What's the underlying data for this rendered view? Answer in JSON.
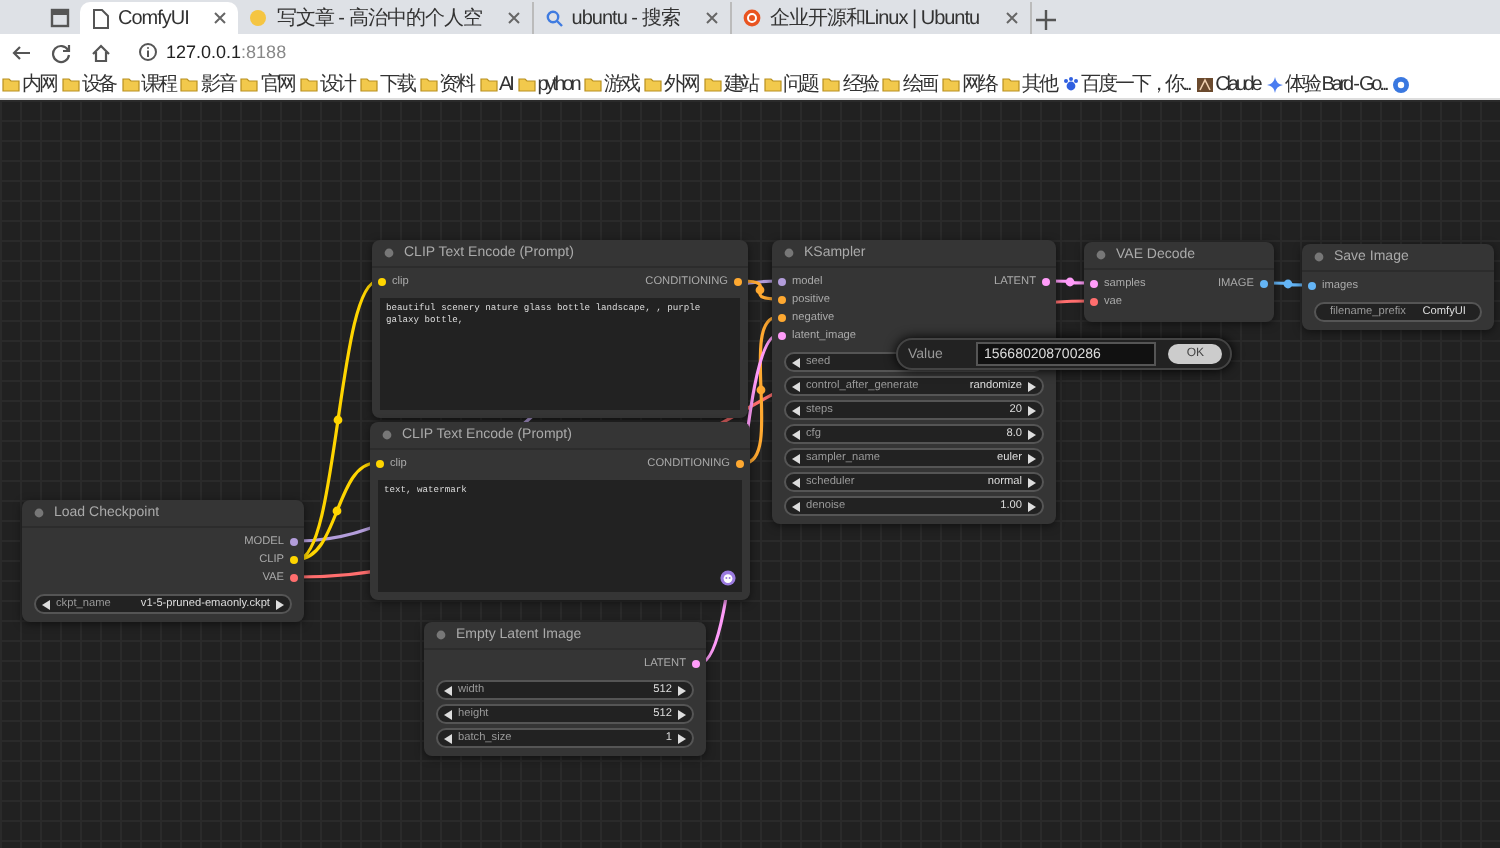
{
  "browser": {
    "tabs": [
      {
        "title": "ComfyUI",
        "selected": true
      },
      {
        "title": "写文章 - 高治中的个人空",
        "selected": false
      },
      {
        "title": "ubuntu - 搜索",
        "selected": false
      },
      {
        "title": "企业开源和Linux | Ubuntu",
        "selected": false
      }
    ],
    "url": {
      "host": "127.0.0.1",
      "port": ":8188"
    },
    "bookmarks": [
      {
        "label": "内网",
        "kind": "folder"
      },
      {
        "label": "设备",
        "kind": "folder"
      },
      {
        "label": "课程",
        "kind": "folder"
      },
      {
        "label": "影音",
        "kind": "folder"
      },
      {
        "label": "官网",
        "kind": "folder"
      },
      {
        "label": "设计",
        "kind": "folder"
      },
      {
        "label": "下载",
        "kind": "folder"
      },
      {
        "label": "资料",
        "kind": "folder"
      },
      {
        "label": "AI",
        "kind": "folder"
      },
      {
        "label": "python",
        "kind": "folder"
      },
      {
        "label": "游戏",
        "kind": "folder"
      },
      {
        "label": "外网",
        "kind": "folder"
      },
      {
        "label": "建站",
        "kind": "folder"
      },
      {
        "label": "问题",
        "kind": "folder"
      },
      {
        "label": "经验",
        "kind": "folder"
      },
      {
        "label": "绘画",
        "kind": "folder"
      },
      {
        "label": "网络",
        "kind": "folder"
      },
      {
        "label": "其他",
        "kind": "folder"
      },
      {
        "label": "百度一下，你...",
        "kind": "baidu"
      },
      {
        "label": "Claude",
        "kind": "claude"
      },
      {
        "label": "体验 Bard - Go...",
        "kind": "bard"
      }
    ]
  },
  "nodes": [
    {
      "title": "CLIP Text Encode (Prompt)",
      "inputs": [
        {
          "name": "clip",
          "color": "#ffd500"
        }
      ],
      "outputs": [
        {
          "name": "CONDITIONING",
          "color": "#ffa931"
        }
      ],
      "widgets": [
        {
          "kind": "textarea",
          "value": "beautiful scenery nature glass bottle landscape, , purple galaxy bottle,"
        }
      ]
    },
    {
      "title": "KSampler",
      "inputs": [
        {
          "name": "model",
          "color": "#b39ddb"
        },
        {
          "name": "positive",
          "color": "#ffa931"
        },
        {
          "name": "negative",
          "color": "#ffa931"
        },
        {
          "name": "latent_image",
          "color": "#ff9cf9"
        }
      ],
      "outputs": [
        {
          "name": "LATENT",
          "color": "#ff9cf9"
        }
      ],
      "widgets": [
        {
          "kind": "number",
          "name": "seed"
        },
        {
          "kind": "combo",
          "name": "control_after_generate",
          "value": "randomize"
        },
        {
          "kind": "number",
          "name": "steps",
          "value": "20"
        },
        {
          "kind": "number",
          "name": "cfg",
          "value": "8.0"
        },
        {
          "kind": "combo",
          "name": "sampler_name",
          "value": "euler"
        },
        {
          "kind": "combo",
          "name": "scheduler",
          "value": "normal"
        },
        {
          "kind": "number",
          "name": "denoise",
          "value": "1.00"
        }
      ]
    },
    {
      "title": "VAE Decode",
      "inputs": [
        {
          "name": "samples",
          "color": "#ff9cf9"
        },
        {
          "name": "vae",
          "color": "#ff6e6e"
        }
      ],
      "outputs": [
        {
          "name": "IMAGE",
          "color": "#64b5f6"
        }
      ]
    },
    {
      "title": "Save Image",
      "inputs": [
        {
          "name": "images",
          "color": "#64b5f6"
        }
      ],
      "widgets": [
        {
          "kind": "text",
          "name": "filename_prefix",
          "value": "ComfyUI"
        }
      ]
    },
    {
      "title": "CLIP Text Encode (Prompt)",
      "inputs": [
        {
          "name": "clip",
          "color": "#ffd500"
        }
      ],
      "outputs": [
        {
          "name": "CONDITIONING",
          "color": "#ffa931"
        }
      ],
      "widgets": [
        {
          "kind": "textarea",
          "value": "text, watermark",
          "icon": true
        }
      ]
    },
    {
      "title": "Load Checkpoint",
      "outputs": [
        {
          "name": "MODEL",
          "color": "#b39ddb"
        },
        {
          "name": "CLIP",
          "color": "#ffd500"
        },
        {
          "name": "VAE",
          "color": "#ff6e6e"
        }
      ],
      "widgets": [
        {
          "kind": "combo",
          "name": "ckpt_name",
          "value": "v1-5-pruned-emaonly.ckpt"
        }
      ]
    },
    {
      "title": "Empty Latent Image",
      "outputs": [
        {
          "name": "LATENT",
          "color": "#ff9cf9"
        }
      ],
      "widgets": [
        {
          "kind": "number",
          "name": "width",
          "value": "512"
        },
        {
          "kind": "number",
          "name": "height",
          "value": "512"
        },
        {
          "kind": "number",
          "name": "batch_size",
          "value": "1"
        }
      ]
    }
  ],
  "value_dialog": {
    "label": "Value",
    "value": "156680208700286",
    "button": "OK"
  }
}
